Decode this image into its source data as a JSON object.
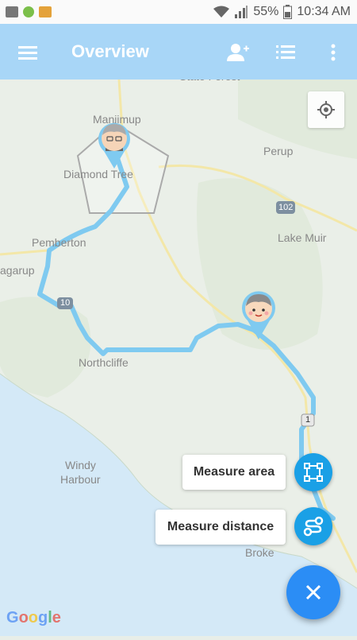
{
  "status_bar": {
    "battery": "55%",
    "time": "10:34 AM"
  },
  "app_bar": {
    "title": "Overview"
  },
  "map": {
    "labels": {
      "state_forest": "State Forest",
      "manjimup": "Manjimup",
      "diamond_tree": "Diamond Tree",
      "perup": "Perup",
      "road_102": "102",
      "lake_muir": "Lake Muir",
      "pemberton": "Pemberton",
      "quinninup": "agarup",
      "road_10": "10",
      "northcliffe": "Northcliffe",
      "road_1": "1",
      "windy": "Windy",
      "harbour": "Harbour",
      "broke": "Broke"
    },
    "attribution": "Google"
  },
  "fab_menu": {
    "measure_area": "Measure area",
    "measure_distance": "Measure distance"
  },
  "colors": {
    "app_bar": "#a8d6f7",
    "route": "#7fcaf0",
    "fab": "#2b8df5",
    "mini_fab": "#1aa0e6"
  }
}
